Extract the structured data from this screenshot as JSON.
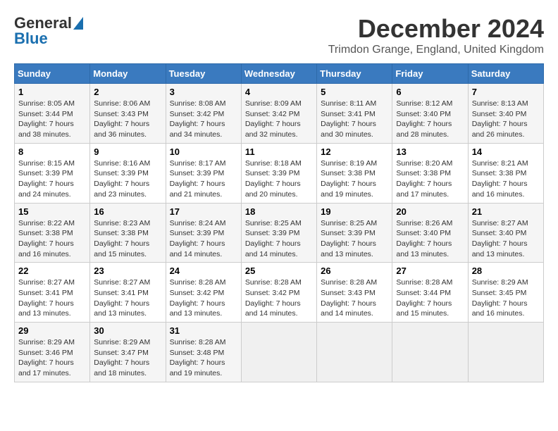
{
  "header": {
    "logo_line1": "General",
    "logo_line2": "Blue",
    "title": "December 2024",
    "subtitle": "Trimdon Grange, England, United Kingdom"
  },
  "weekdays": [
    "Sunday",
    "Monday",
    "Tuesday",
    "Wednesday",
    "Thursday",
    "Friday",
    "Saturday"
  ],
  "weeks": [
    [
      {
        "day": "1",
        "sunrise": "8:05 AM",
        "sunset": "3:44 PM",
        "daylight": "7 hours and 38 minutes."
      },
      {
        "day": "2",
        "sunrise": "8:06 AM",
        "sunset": "3:43 PM",
        "daylight": "7 hours and 36 minutes."
      },
      {
        "day": "3",
        "sunrise": "8:08 AM",
        "sunset": "3:42 PM",
        "daylight": "7 hours and 34 minutes."
      },
      {
        "day": "4",
        "sunrise": "8:09 AM",
        "sunset": "3:42 PM",
        "daylight": "7 hours and 32 minutes."
      },
      {
        "day": "5",
        "sunrise": "8:11 AM",
        "sunset": "3:41 PM",
        "daylight": "7 hours and 30 minutes."
      },
      {
        "day": "6",
        "sunrise": "8:12 AM",
        "sunset": "3:40 PM",
        "daylight": "7 hours and 28 minutes."
      },
      {
        "day": "7",
        "sunrise": "8:13 AM",
        "sunset": "3:40 PM",
        "daylight": "7 hours and 26 minutes."
      }
    ],
    [
      {
        "day": "8",
        "sunrise": "8:15 AM",
        "sunset": "3:39 PM",
        "daylight": "7 hours and 24 minutes."
      },
      {
        "day": "9",
        "sunrise": "8:16 AM",
        "sunset": "3:39 PM",
        "daylight": "7 hours and 23 minutes."
      },
      {
        "day": "10",
        "sunrise": "8:17 AM",
        "sunset": "3:39 PM",
        "daylight": "7 hours and 21 minutes."
      },
      {
        "day": "11",
        "sunrise": "8:18 AM",
        "sunset": "3:39 PM",
        "daylight": "7 hours and 20 minutes."
      },
      {
        "day": "12",
        "sunrise": "8:19 AM",
        "sunset": "3:38 PM",
        "daylight": "7 hours and 19 minutes."
      },
      {
        "day": "13",
        "sunrise": "8:20 AM",
        "sunset": "3:38 PM",
        "daylight": "7 hours and 17 minutes."
      },
      {
        "day": "14",
        "sunrise": "8:21 AM",
        "sunset": "3:38 PM",
        "daylight": "7 hours and 16 minutes."
      }
    ],
    [
      {
        "day": "15",
        "sunrise": "8:22 AM",
        "sunset": "3:38 PM",
        "daylight": "7 hours and 16 minutes."
      },
      {
        "day": "16",
        "sunrise": "8:23 AM",
        "sunset": "3:38 PM",
        "daylight": "7 hours and 15 minutes."
      },
      {
        "day": "17",
        "sunrise": "8:24 AM",
        "sunset": "3:39 PM",
        "daylight": "7 hours and 14 minutes."
      },
      {
        "day": "18",
        "sunrise": "8:25 AM",
        "sunset": "3:39 PM",
        "daylight": "7 hours and 14 minutes."
      },
      {
        "day": "19",
        "sunrise": "8:25 AM",
        "sunset": "3:39 PM",
        "daylight": "7 hours and 13 minutes."
      },
      {
        "day": "20",
        "sunrise": "8:26 AM",
        "sunset": "3:40 PM",
        "daylight": "7 hours and 13 minutes."
      },
      {
        "day": "21",
        "sunrise": "8:27 AM",
        "sunset": "3:40 PM",
        "daylight": "7 hours and 13 minutes."
      }
    ],
    [
      {
        "day": "22",
        "sunrise": "8:27 AM",
        "sunset": "3:41 PM",
        "daylight": "7 hours and 13 minutes."
      },
      {
        "day": "23",
        "sunrise": "8:27 AM",
        "sunset": "3:41 PM",
        "daylight": "7 hours and 13 minutes."
      },
      {
        "day": "24",
        "sunrise": "8:28 AM",
        "sunset": "3:42 PM",
        "daylight": "7 hours and 13 minutes."
      },
      {
        "day": "25",
        "sunrise": "8:28 AM",
        "sunset": "3:42 PM",
        "daylight": "7 hours and 14 minutes."
      },
      {
        "day": "26",
        "sunrise": "8:28 AM",
        "sunset": "3:43 PM",
        "daylight": "7 hours and 14 minutes."
      },
      {
        "day": "27",
        "sunrise": "8:28 AM",
        "sunset": "3:44 PM",
        "daylight": "7 hours and 15 minutes."
      },
      {
        "day": "28",
        "sunrise": "8:29 AM",
        "sunset": "3:45 PM",
        "daylight": "7 hours and 16 minutes."
      }
    ],
    [
      {
        "day": "29",
        "sunrise": "8:29 AM",
        "sunset": "3:46 PM",
        "daylight": "7 hours and 17 minutes."
      },
      {
        "day": "30",
        "sunrise": "8:29 AM",
        "sunset": "3:47 PM",
        "daylight": "7 hours and 18 minutes."
      },
      {
        "day": "31",
        "sunrise": "8:28 AM",
        "sunset": "3:48 PM",
        "daylight": "7 hours and 19 minutes."
      },
      null,
      null,
      null,
      null
    ]
  ]
}
